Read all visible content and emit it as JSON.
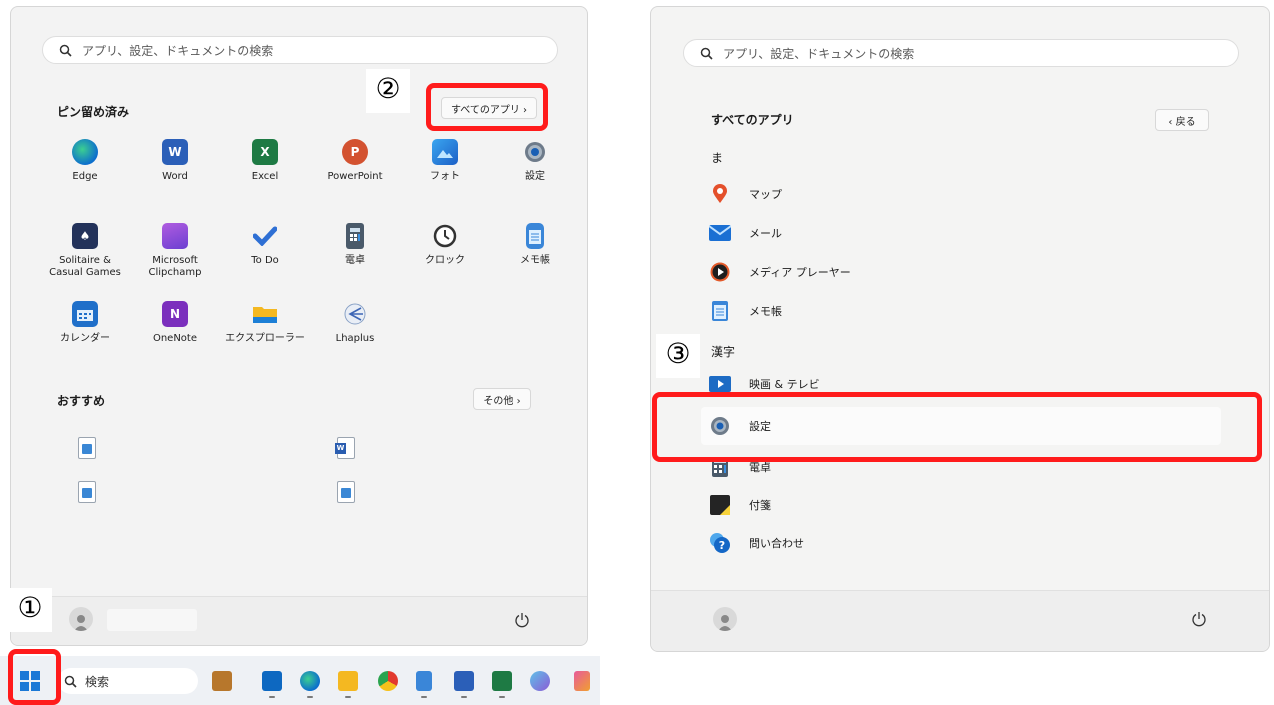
{
  "left": {
    "search_placeholder": "アプリ、設定、ドキュメントの検索",
    "pinned_title": "ピン留め済み",
    "all_apps_label": "すべてのアプリ  ›",
    "apps": [
      {
        "label": "Edge",
        "icon": "edge-icon"
      },
      {
        "label": "Word",
        "icon": "word-icon"
      },
      {
        "label": "Excel",
        "icon": "excel-icon"
      },
      {
        "label": "PowerPoint",
        "icon": "powerpoint-icon"
      },
      {
        "label": "フォト",
        "icon": "photos-icon"
      },
      {
        "label": "設定",
        "icon": "settings-gear-icon"
      },
      {
        "label": "Solitaire &\nCasual Games",
        "icon": "solitaire-icon"
      },
      {
        "label": "Microsoft\nClipchamp",
        "icon": "clipchamp-icon"
      },
      {
        "label": "To Do",
        "icon": "todo-check-icon"
      },
      {
        "label": "電卓",
        "icon": "calculator-icon"
      },
      {
        "label": "クロック",
        "icon": "clock-icon"
      },
      {
        "label": "メモ帳",
        "icon": "notepad-icon"
      },
      {
        "label": "カレンダー",
        "icon": "calendar-icon"
      },
      {
        "label": "OneNote",
        "icon": "onenote-icon"
      },
      {
        "label": "エクスプローラー",
        "icon": "folder-icon"
      },
      {
        "label": "Lhaplus",
        "icon": "lhaplus-icon"
      }
    ],
    "recommended_title": "おすすめ",
    "more_label": "その他  ›"
  },
  "right": {
    "search_placeholder": "アプリ、設定、ドキュメントの検索",
    "all_apps_title": "すべてのアプリ",
    "back_label": "‹  戻る",
    "group_ma": "ま",
    "group_kanji": "漢字",
    "items": [
      {
        "label": "マップ",
        "icon": "maps-pin-icon"
      },
      {
        "label": "メール",
        "icon": "mail-icon"
      },
      {
        "label": "メディア プレーヤー",
        "icon": "media-player-icon"
      },
      {
        "label": "メモ帳",
        "icon": "notepad-icon"
      },
      {
        "label": "映画 & テレビ",
        "icon": "movies-tv-icon"
      },
      {
        "label": "設定",
        "icon": "settings-gear-icon"
      },
      {
        "label": "電卓",
        "icon": "calculator-icon"
      },
      {
        "label": "付箋",
        "icon": "sticky-notes-icon"
      },
      {
        "label": "問い合わせ",
        "icon": "get-help-icon"
      }
    ]
  },
  "taskbar": {
    "search_label": "検索"
  },
  "markers": {
    "step1": "①",
    "step2": "②",
    "step3": "③"
  },
  "colors": {
    "highlight_red": "#ff1b1b",
    "accent_blue": "#0067c0"
  }
}
